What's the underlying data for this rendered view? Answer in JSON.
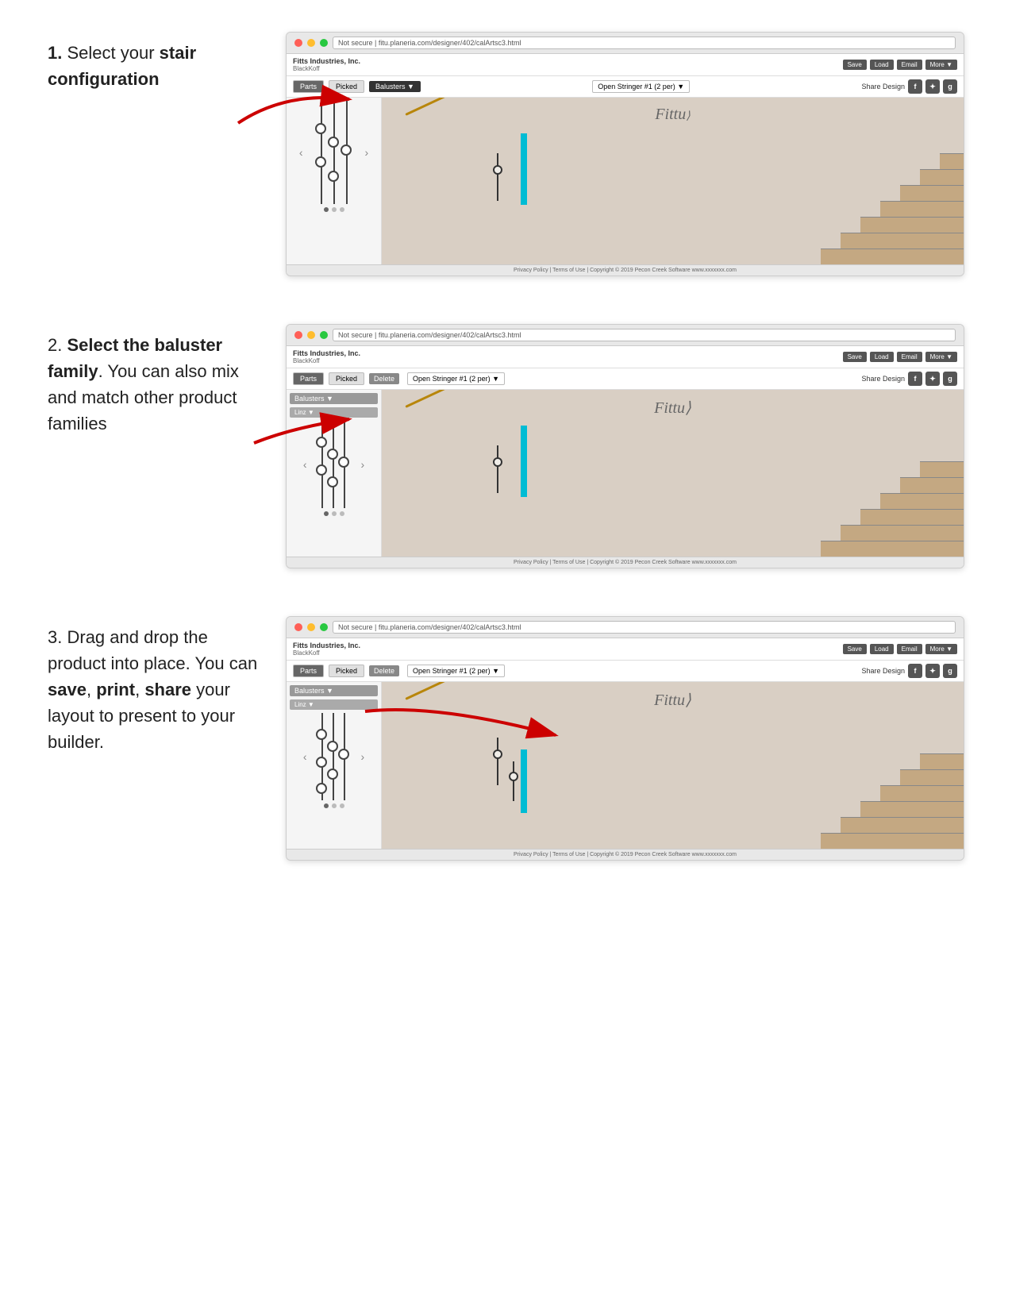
{
  "steps": [
    {
      "number": "1.",
      "text_before": " Select your ",
      "text_bold1": "stair configuration",
      "text_after": "",
      "text_extra": "",
      "show_linz": false
    },
    {
      "number": "2.",
      "text_before": " ",
      "text_bold1": "Select the baluster family",
      "text_after": ".  You can also mix and match other product families",
      "text_extra": "",
      "show_linz": true
    },
    {
      "number": "3.",
      "text_before": " Drag and drop the product into place. You can ",
      "text_bold1": "save",
      "text_middle": ", ",
      "text_bold2": "print",
      "text_middle2": ", ",
      "text_bold3": "share",
      "text_after": " your layout to present to your builder.",
      "text_extra": "",
      "show_linz": true
    }
  ],
  "browser": {
    "url": "Not secure | fitu.planeria.com/designer/402/calArtsc3.html",
    "brand_name": "Fitts Industries, Inc.",
    "brand_sub": "BlackKoff",
    "buttons": {
      "save": "Save",
      "load": "Load",
      "email": "Email",
      "more": "More ▼"
    },
    "tabs": {
      "parts": "Parts",
      "picked": "Picked"
    },
    "delete_btn": "Delete",
    "stringer": "Open Stringer #1 (2 per) ▼",
    "share": "Share Design",
    "balusters_label": "Balusters ▼",
    "linz_label": "Linz ▼",
    "footer_text": "Privacy Policy  |  Terms of Use  |  Copyright © 2019 Pecon Creek Software  www.xxxxxxx.com"
  },
  "colors": {
    "accent_red": "#cc0000",
    "cyan_post": "#00bcd4",
    "toolbar_btn": "#666666",
    "tab_active": "#555555"
  }
}
